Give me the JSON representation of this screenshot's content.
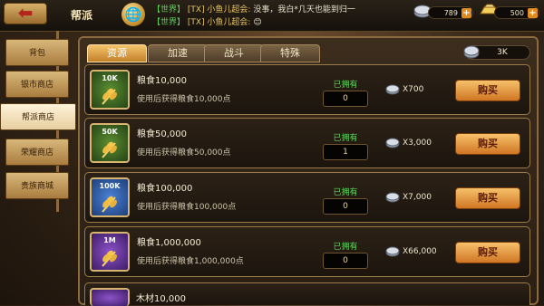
{
  "header": {
    "back_icon": "back-arrow-icon",
    "title": "帮派",
    "chat": [
      {
        "channel": "【世界】",
        "sender": "[TX] 小鱼儿超会:",
        "text": "没事，我白*几天也能到归一"
      },
      {
        "channel": "【世界】",
        "sender": "[TX] 小鱼儿超会:",
        "text": ""
      }
    ],
    "resources": [
      {
        "icon": "silver-coin-icon",
        "value": "789"
      },
      {
        "icon": "gold-ingot-icon",
        "value": "500"
      }
    ]
  },
  "sidebar": {
    "items": [
      {
        "label": "背包"
      },
      {
        "label": "银市商店"
      },
      {
        "label": "帮派商店"
      },
      {
        "label": "荣耀商店"
      },
      {
        "label": "贵族商城"
      }
    ],
    "active_index": 2
  },
  "tabs": [
    {
      "label": "资源"
    },
    {
      "label": "加速"
    },
    {
      "label": "战斗"
    },
    {
      "label": "特殊"
    }
  ],
  "currency": {
    "icon": "silver-coin-icon",
    "value": "3K"
  },
  "items": [
    {
      "badge": "10K",
      "color": "green",
      "name": "粮食10,000",
      "desc": "使用后获得粮食10,000点",
      "owned_label": "已拥有",
      "owned": "0",
      "price": "X700",
      "buy": "购买"
    },
    {
      "badge": "50K",
      "color": "green",
      "name": "粮食50,000",
      "desc": "使用后获得粮食50,000点",
      "owned_label": "已拥有",
      "owned": "1",
      "price": "X3,000",
      "buy": "购买"
    },
    {
      "badge": "100K",
      "color": "blue",
      "name": "粮食100,000",
      "desc": "使用后获得粮食100,000点",
      "owned_label": "已拥有",
      "owned": "0",
      "price": "X7,000",
      "buy": "购买"
    },
    {
      "badge": "1M",
      "color": "purple",
      "name": "粮食1,000,000",
      "desc": "使用后获得粮食1,000,000点",
      "owned_label": "已拥有",
      "owned": "0",
      "price": "X66,000",
      "buy": "购买"
    }
  ],
  "next_item_partial": "木材10,000",
  "colors": {
    "accent": "#e08a1f",
    "owned_green": "#5fd35a",
    "panel_border": "#8a6a3e"
  }
}
